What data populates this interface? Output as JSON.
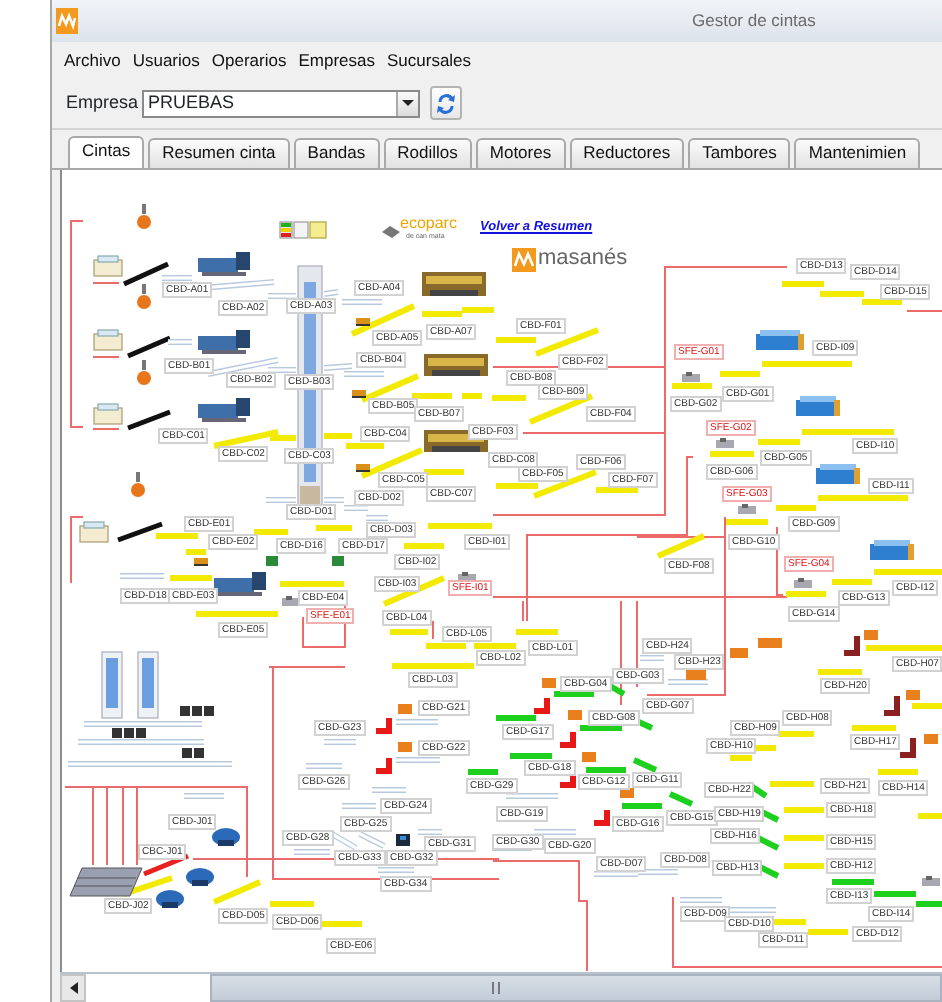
{
  "window": {
    "title": "Gestor de cintas"
  },
  "menu": [
    "Archivo",
    "Usuarios",
    "Operarios",
    "Empresas",
    "Sucursales"
  ],
  "company": {
    "label": "Empresa",
    "value": "PRUEBAS"
  },
  "tabs": [
    {
      "label": "Cintas",
      "selected": true
    },
    {
      "label": "Resumen cinta",
      "selected": false
    },
    {
      "label": "Bandas",
      "selected": false
    },
    {
      "label": "Rodillos",
      "selected": false
    },
    {
      "label": "Motores",
      "selected": false
    },
    {
      "label": "Reductores",
      "selected": false
    },
    {
      "label": "Tambores",
      "selected": false
    },
    {
      "label": "Mantenimien",
      "selected": false
    }
  ],
  "diagram": {
    "logos": [
      {
        "name": "ecoparc",
        "tagline": "de can mata"
      },
      {
        "name": "masanés"
      }
    ],
    "link": "Volver a Resumen",
    "labels": [
      {
        "text": "CBD-A01",
        "kind": "conveyor"
      },
      {
        "text": "CBD-A02",
        "kind": "conveyor"
      },
      {
        "text": "CBD-A03",
        "kind": "conveyor"
      },
      {
        "text": "CBD-A04",
        "kind": "conveyor"
      },
      {
        "text": "CBD-A05",
        "kind": "conveyor"
      },
      {
        "text": "CBD-A07",
        "kind": "conveyor"
      },
      {
        "text": "CBD-B01",
        "kind": "conveyor"
      },
      {
        "text": "CBD-B02",
        "kind": "conveyor"
      },
      {
        "text": "CBD-B03",
        "kind": "conveyor"
      },
      {
        "text": "CBD-B04",
        "kind": "conveyor"
      },
      {
        "text": "CBD-B05",
        "kind": "conveyor"
      },
      {
        "text": "CBD-B07",
        "kind": "conveyor"
      },
      {
        "text": "CBD-C01",
        "kind": "conveyor"
      },
      {
        "text": "CBD-C02",
        "kind": "conveyor"
      },
      {
        "text": "CBD-C03",
        "kind": "conveyor"
      },
      {
        "text": "CBD-C04",
        "kind": "conveyor"
      },
      {
        "text": "CBD-C05",
        "kind": "conveyor"
      },
      {
        "text": "CBD-C07",
        "kind": "conveyor"
      },
      {
        "text": "CBD-D01",
        "kind": "conveyor"
      },
      {
        "text": "CBD-D02",
        "kind": "conveyor"
      },
      {
        "text": "CBD-D03",
        "kind": "conveyor"
      },
      {
        "text": "CBD-D16",
        "kind": "conveyor"
      },
      {
        "text": "CBD-D17",
        "kind": "conveyor"
      },
      {
        "text": "CBD-E01",
        "kind": "conveyor"
      },
      {
        "text": "CBD-E02",
        "kind": "conveyor"
      },
      {
        "text": "CBD-I01",
        "kind": "conveyor"
      },
      {
        "text": "CBD-I02",
        "kind": "conveyor"
      },
      {
        "text": "CBD-F01",
        "kind": "conveyor"
      },
      {
        "text": "CBD-F02",
        "kind": "conveyor"
      },
      {
        "text": "CBD-B08",
        "kind": "conveyor"
      },
      {
        "text": "CBD-B09",
        "kind": "conveyor"
      },
      {
        "text": "CBD-F04",
        "kind": "conveyor"
      },
      {
        "text": "CBD-F03",
        "kind": "conveyor"
      },
      {
        "text": "CBD-C08",
        "kind": "conveyor"
      },
      {
        "text": "CBD-F05",
        "kind": "conveyor"
      },
      {
        "text": "CBD-F06",
        "kind": "conveyor"
      },
      {
        "text": "CBD-F07",
        "kind": "conveyor"
      },
      {
        "text": "CBD-D13",
        "kind": "conveyor"
      },
      {
        "text": "CBD-D14",
        "kind": "conveyor"
      },
      {
        "text": "CBD-D15",
        "kind": "conveyor"
      },
      {
        "text": "CBD-I09",
        "kind": "conveyor"
      },
      {
        "text": "CBD-I10",
        "kind": "conveyor"
      },
      {
        "text": "CBD-I11",
        "kind": "conveyor"
      },
      {
        "text": "CBD-I12",
        "kind": "conveyor"
      },
      {
        "text": "SFE-G01",
        "kind": "sensor"
      },
      {
        "text": "CBD-G01",
        "kind": "conveyor"
      },
      {
        "text": "CBD-G02",
        "kind": "conveyor"
      },
      {
        "text": "SFE-G02",
        "kind": "sensor"
      },
      {
        "text": "CBD-G05",
        "kind": "conveyor"
      },
      {
        "text": "CBD-G06",
        "kind": "conveyor"
      },
      {
        "text": "SFE-G03",
        "kind": "sensor"
      },
      {
        "text": "CBD-G09",
        "kind": "conveyor"
      },
      {
        "text": "CBD-G10",
        "kind": "conveyor"
      },
      {
        "text": "CBD-F08",
        "kind": "conveyor"
      },
      {
        "text": "SFE-G04",
        "kind": "sensor"
      },
      {
        "text": "CBD-G13",
        "kind": "conveyor"
      },
      {
        "text": "CBD-G14",
        "kind": "conveyor"
      },
      {
        "text": "CBD-D18",
        "kind": "conveyor"
      },
      {
        "text": "CBD-E03",
        "kind": "conveyor"
      },
      {
        "text": "CBD-E04",
        "kind": "conveyor"
      },
      {
        "text": "SFE-E01",
        "kind": "sensor"
      },
      {
        "text": "CBD-E05",
        "kind": "conveyor"
      },
      {
        "text": "CBD-I03",
        "kind": "conveyor"
      },
      {
        "text": "SFE-I01",
        "kind": "sensor"
      },
      {
        "text": "CBD-L04",
        "kind": "conveyor"
      },
      {
        "text": "CBD-L05",
        "kind": "conveyor"
      },
      {
        "text": "CBD-L03",
        "kind": "conveyor"
      },
      {
        "text": "CBD-G21",
        "kind": "conveyor"
      },
      {
        "text": "CBD-G22",
        "kind": "conveyor"
      },
      {
        "text": "CBD-G23",
        "kind": "conveyor"
      },
      {
        "text": "CBD-G26",
        "kind": "conveyor"
      },
      {
        "text": "CBD-G24",
        "kind": "conveyor"
      },
      {
        "text": "CBD-G25",
        "kind": "conveyor"
      },
      {
        "text": "CBD-G28",
        "kind": "conveyor"
      },
      {
        "text": "CBD-G33",
        "kind": "conveyor"
      },
      {
        "text": "CBD-G32",
        "kind": "conveyor"
      },
      {
        "text": "CBD-G31",
        "kind": "conveyor"
      },
      {
        "text": "CBD-G34",
        "kind": "conveyor"
      },
      {
        "text": "CBD-J01",
        "kind": "conveyor"
      },
      {
        "text": "CBC-J01",
        "kind": "conveyor"
      },
      {
        "text": "CBD-J02",
        "kind": "conveyor"
      },
      {
        "text": "CBD-D05",
        "kind": "conveyor"
      },
      {
        "text": "CBD-D06",
        "kind": "conveyor"
      },
      {
        "text": "CBD-E06",
        "kind": "conveyor"
      },
      {
        "text": "CBD-L01",
        "kind": "conveyor"
      },
      {
        "text": "CBD-L02",
        "kind": "conveyor"
      },
      {
        "text": "CBD-H24",
        "kind": "conveyor"
      },
      {
        "text": "CBD-H23",
        "kind": "conveyor"
      },
      {
        "text": "CBD-G03",
        "kind": "conveyor"
      },
      {
        "text": "CBD-G04",
        "kind": "conveyor"
      },
      {
        "text": "CBD-G07",
        "kind": "conveyor"
      },
      {
        "text": "CBD-G17",
        "kind": "conveyor"
      },
      {
        "text": "CBD-G08",
        "kind": "conveyor"
      },
      {
        "text": "CBD-G18",
        "kind": "conveyor"
      },
      {
        "text": "CBD-G12",
        "kind": "conveyor"
      },
      {
        "text": "CBD-G11",
        "kind": "conveyor"
      },
      {
        "text": "CBD-G29",
        "kind": "conveyor"
      },
      {
        "text": "CBD-G19",
        "kind": "conveyor"
      },
      {
        "text": "CBD-G16",
        "kind": "conveyor"
      },
      {
        "text": "CBD-G15",
        "kind": "conveyor"
      },
      {
        "text": "CBD-G30",
        "kind": "conveyor"
      },
      {
        "text": "CBD-G20",
        "kind": "conveyor"
      },
      {
        "text": "CBD-D07",
        "kind": "conveyor"
      },
      {
        "text": "CBD-D08",
        "kind": "conveyor"
      },
      {
        "text": "CBD-D09",
        "kind": "conveyor"
      },
      {
        "text": "CBD-D10",
        "kind": "conveyor"
      },
      {
        "text": "CBD-D11",
        "kind": "conveyor"
      },
      {
        "text": "CBD-D12",
        "kind": "conveyor"
      },
      {
        "text": "CBD-H20",
        "kind": "conveyor"
      },
      {
        "text": "CBD-H07",
        "kind": "conveyor"
      },
      {
        "text": "CBD-H08",
        "kind": "conveyor"
      },
      {
        "text": "CBD-H09",
        "kind": "conveyor"
      },
      {
        "text": "CBD-H10",
        "kind": "conveyor"
      },
      {
        "text": "CBD-H17",
        "kind": "conveyor"
      },
      {
        "text": "CBD-H22",
        "kind": "conveyor"
      },
      {
        "text": "CBD-H21",
        "kind": "conveyor"
      },
      {
        "text": "CBD-H14",
        "kind": "conveyor"
      },
      {
        "text": "CBD-H19",
        "kind": "conveyor"
      },
      {
        "text": "CBD-H18",
        "kind": "conveyor"
      },
      {
        "text": "CBD-H16",
        "kind": "conveyor"
      },
      {
        "text": "CBD-H15",
        "kind": "conveyor"
      },
      {
        "text": "CBD-H13",
        "kind": "conveyor"
      },
      {
        "text": "CBD-H12",
        "kind": "conveyor"
      },
      {
        "text": "CBD-I13",
        "kind": "conveyor"
      },
      {
        "text": "CBD-I14",
        "kind": "conveyor"
      }
    ]
  }
}
